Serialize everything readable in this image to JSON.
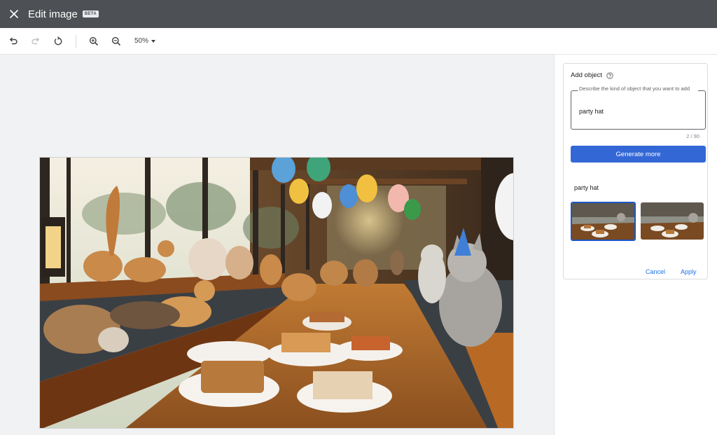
{
  "header": {
    "title": "Edit image",
    "badge": "BETA",
    "close_icon": "close-icon"
  },
  "toolbar": {
    "tools": [
      "undo-icon",
      "redo-icon",
      "rotate-icon",
      "zoom-in-icon",
      "zoom-out-icon"
    ],
    "zoom_level": "50%"
  },
  "image": {
    "description_icon": "image-preview"
  },
  "panel": {
    "title": "Add object",
    "help_icon": "help-icon",
    "input_label": "Describe the kind of object that you want to add",
    "input_value": "party hat",
    "counter": "2 / 90",
    "generate_label": "Generate more",
    "result_label": "party hat",
    "cancel_label": "Cancel",
    "apply_label": "Apply"
  },
  "colors": {
    "header_bg": "#4d5054",
    "accent": "#3367d6",
    "link": "#1a73e8"
  }
}
